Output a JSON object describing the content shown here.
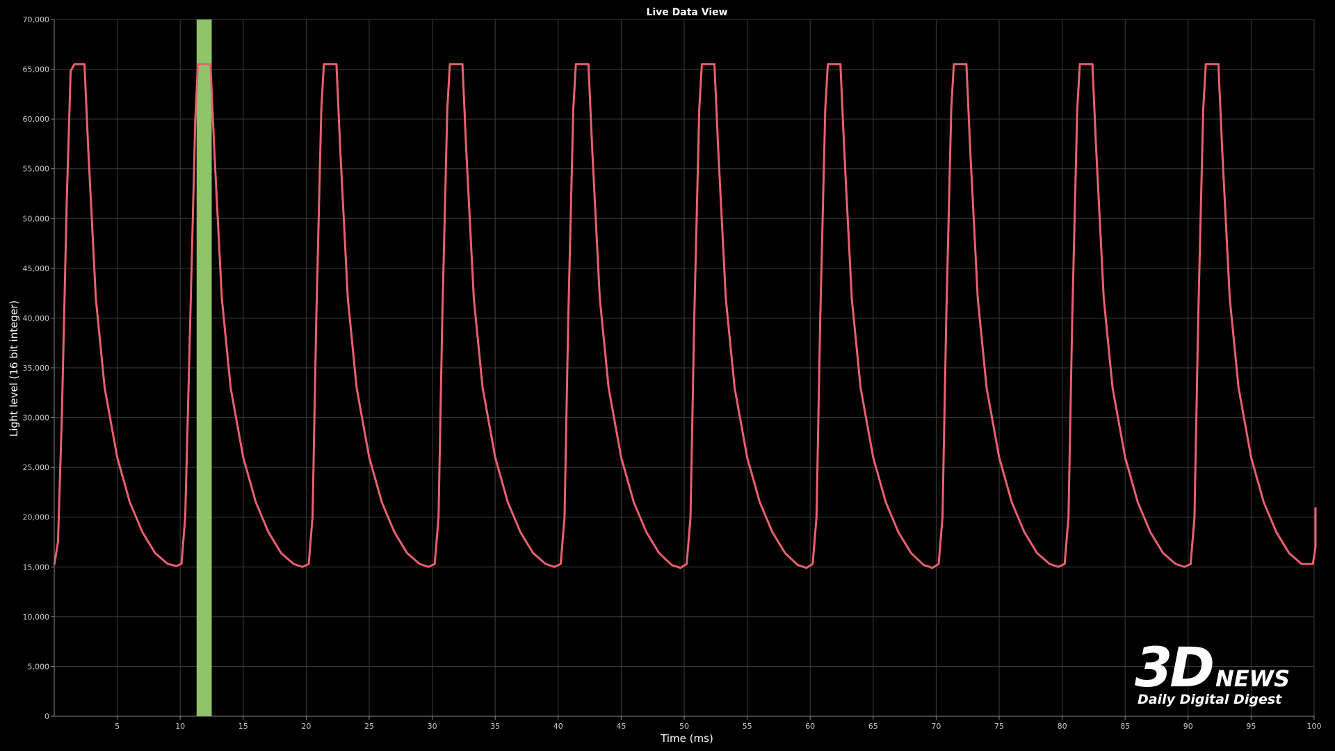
{
  "chart_data": {
    "type": "line",
    "title": "Live Data View",
    "xlabel": "Time (ms)",
    "ylabel": "Light level (16 bit integer)",
    "xlim": [
      0,
      100
    ],
    "ylim": [
      0,
      70000
    ],
    "grid": true,
    "x_ticks": [
      5,
      10,
      15,
      20,
      25,
      30,
      35,
      40,
      45,
      50,
      55,
      60,
      65,
      70,
      75,
      80,
      85,
      90,
      95,
      100
    ],
    "x_tick_labels": [
      "5",
      "10",
      "15",
      "20",
      "25",
      "30",
      "35",
      "40",
      "45",
      "50",
      "55",
      "60",
      "65",
      "70",
      "75",
      "80",
      "85",
      "90",
      "95",
      "100"
    ],
    "y_ticks": [
      0,
      5000,
      10000,
      15000,
      20000,
      25000,
      30000,
      35000,
      40000,
      45000,
      50000,
      55000,
      60000,
      65000,
      70000
    ],
    "y_tick_labels": [
      "0",
      "5,000",
      "10,000",
      "15,000",
      "20,000",
      "25,000",
      "30,000",
      "35,000",
      "40,000",
      "45,000",
      "50,000",
      "55,000",
      "60,000",
      "65,000",
      "70,000"
    ],
    "highlight_band": {
      "x_start": 11.3,
      "x_end": 12.5,
      "color": "#8fc46a"
    },
    "series": [
      {
        "color": "#e8606e",
        "points": [
          [
            0,
            15200
          ],
          [
            0.3,
            17500
          ],
          [
            0.6,
            30000
          ],
          [
            1.0,
            52000
          ],
          [
            1.3,
            64800
          ],
          [
            1.6,
            65500
          ],
          [
            2.4,
            65500
          ],
          [
            2.7,
            57000
          ],
          [
            3.3,
            42000
          ],
          [
            4.0,
            33000
          ],
          [
            5.0,
            26000
          ],
          [
            6.0,
            21500
          ],
          [
            7.0,
            18500
          ],
          [
            8.0,
            16400
          ],
          [
            9.0,
            15300
          ],
          [
            9.7,
            15100
          ],
          [
            10.1,
            15300
          ],
          [
            10.4,
            20000
          ],
          [
            10.8,
            40000
          ],
          [
            11.2,
            60000
          ],
          [
            11.4,
            65500
          ],
          [
            12.4,
            65500
          ],
          [
            12.7,
            57000
          ],
          [
            13.3,
            42000
          ],
          [
            14.0,
            33000
          ],
          [
            15.0,
            26000
          ],
          [
            16.0,
            21500
          ],
          [
            17.0,
            18500
          ],
          [
            18.0,
            16400
          ],
          [
            19.0,
            15300
          ],
          [
            19.7,
            15000
          ],
          [
            20.2,
            15300
          ],
          [
            20.5,
            20000
          ],
          [
            20.8,
            40000
          ],
          [
            21.2,
            61000
          ],
          [
            21.4,
            65500
          ],
          [
            22.4,
            65500
          ],
          [
            22.7,
            57000
          ],
          [
            23.3,
            42000
          ],
          [
            24.0,
            33000
          ],
          [
            25.0,
            26000
          ],
          [
            26.0,
            21500
          ],
          [
            27.0,
            18500
          ],
          [
            28.0,
            16400
          ],
          [
            29.0,
            15300
          ],
          [
            29.7,
            15000
          ],
          [
            30.2,
            15300
          ],
          [
            30.5,
            20000
          ],
          [
            30.8,
            40000
          ],
          [
            31.2,
            61000
          ],
          [
            31.4,
            65500
          ],
          [
            32.4,
            65500
          ],
          [
            32.7,
            57000
          ],
          [
            33.3,
            42000
          ],
          [
            34.0,
            33000
          ],
          [
            35.0,
            26000
          ],
          [
            36.0,
            21500
          ],
          [
            37.0,
            18500
          ],
          [
            38.0,
            16400
          ],
          [
            39.0,
            15300
          ],
          [
            39.7,
            15000
          ],
          [
            40.2,
            15300
          ],
          [
            40.5,
            20000
          ],
          [
            40.8,
            40000
          ],
          [
            41.2,
            61000
          ],
          [
            41.4,
            65500
          ],
          [
            42.4,
            65500
          ],
          [
            42.7,
            57000
          ],
          [
            43.3,
            42000
          ],
          [
            44.0,
            33000
          ],
          [
            45.0,
            26000
          ],
          [
            46.0,
            21500
          ],
          [
            47.0,
            18500
          ],
          [
            48.0,
            16400
          ],
          [
            49.0,
            15200
          ],
          [
            49.7,
            14900
          ],
          [
            50.2,
            15300
          ],
          [
            50.5,
            20000
          ],
          [
            50.8,
            40000
          ],
          [
            51.2,
            61000
          ],
          [
            51.4,
            65500
          ],
          [
            52.4,
            65500
          ],
          [
            52.7,
            57000
          ],
          [
            53.3,
            42000
          ],
          [
            54.0,
            33000
          ],
          [
            55.0,
            26000
          ],
          [
            56.0,
            21500
          ],
          [
            57.0,
            18500
          ],
          [
            58.0,
            16400
          ],
          [
            59.0,
            15200
          ],
          [
            59.7,
            14900
          ],
          [
            60.2,
            15300
          ],
          [
            60.5,
            20000
          ],
          [
            60.8,
            40000
          ],
          [
            61.2,
            61000
          ],
          [
            61.4,
            65500
          ],
          [
            62.4,
            65500
          ],
          [
            62.7,
            57000
          ],
          [
            63.3,
            42000
          ],
          [
            64.0,
            33000
          ],
          [
            65.0,
            26000
          ],
          [
            66.0,
            21500
          ],
          [
            67.0,
            18500
          ],
          [
            68.0,
            16400
          ],
          [
            69.0,
            15200
          ],
          [
            69.7,
            14900
          ],
          [
            70.2,
            15300
          ],
          [
            70.5,
            20000
          ],
          [
            70.8,
            40000
          ],
          [
            71.2,
            61000
          ],
          [
            71.4,
            65500
          ],
          [
            72.4,
            65500
          ],
          [
            72.7,
            57000
          ],
          [
            73.3,
            42000
          ],
          [
            74.0,
            33000
          ],
          [
            75.0,
            26000
          ],
          [
            76.0,
            21500
          ],
          [
            77.0,
            18500
          ],
          [
            78.0,
            16400
          ],
          [
            79.0,
            15300
          ],
          [
            79.7,
            15000
          ],
          [
            80.2,
            15300
          ],
          [
            80.5,
            20000
          ],
          [
            80.8,
            40000
          ],
          [
            81.2,
            61000
          ],
          [
            81.4,
            65500
          ],
          [
            82.4,
            65500
          ],
          [
            82.7,
            57000
          ],
          [
            83.3,
            42000
          ],
          [
            84.0,
            33000
          ],
          [
            85.0,
            26000
          ],
          [
            86.0,
            21500
          ],
          [
            87.0,
            18500
          ],
          [
            88.0,
            16400
          ],
          [
            89.0,
            15300
          ],
          [
            89.7,
            15000
          ],
          [
            90.2,
            15300
          ],
          [
            90.5,
            20000
          ],
          [
            90.8,
            40000
          ],
          [
            91.2,
            61000
          ],
          [
            91.4,
            65500
          ],
          [
            92.4,
            65500
          ],
          [
            92.7,
            57000
          ],
          [
            93.3,
            42000
          ],
          [
            94.0,
            33000
          ],
          [
            95.0,
            26000
          ],
          [
            96.0,
            21500
          ],
          [
            97.0,
            18500
          ],
          [
            98.0,
            16400
          ],
          [
            99.0,
            15300
          ],
          [
            99.9,
            15300
          ],
          [
            100.3,
            17000
          ],
          [
            100.6,
            21000
          ]
        ]
      }
    ]
  },
  "watermark": {
    "big": "3D",
    "brand": "NEWS",
    "tagline": "Daily Digital Digest"
  }
}
